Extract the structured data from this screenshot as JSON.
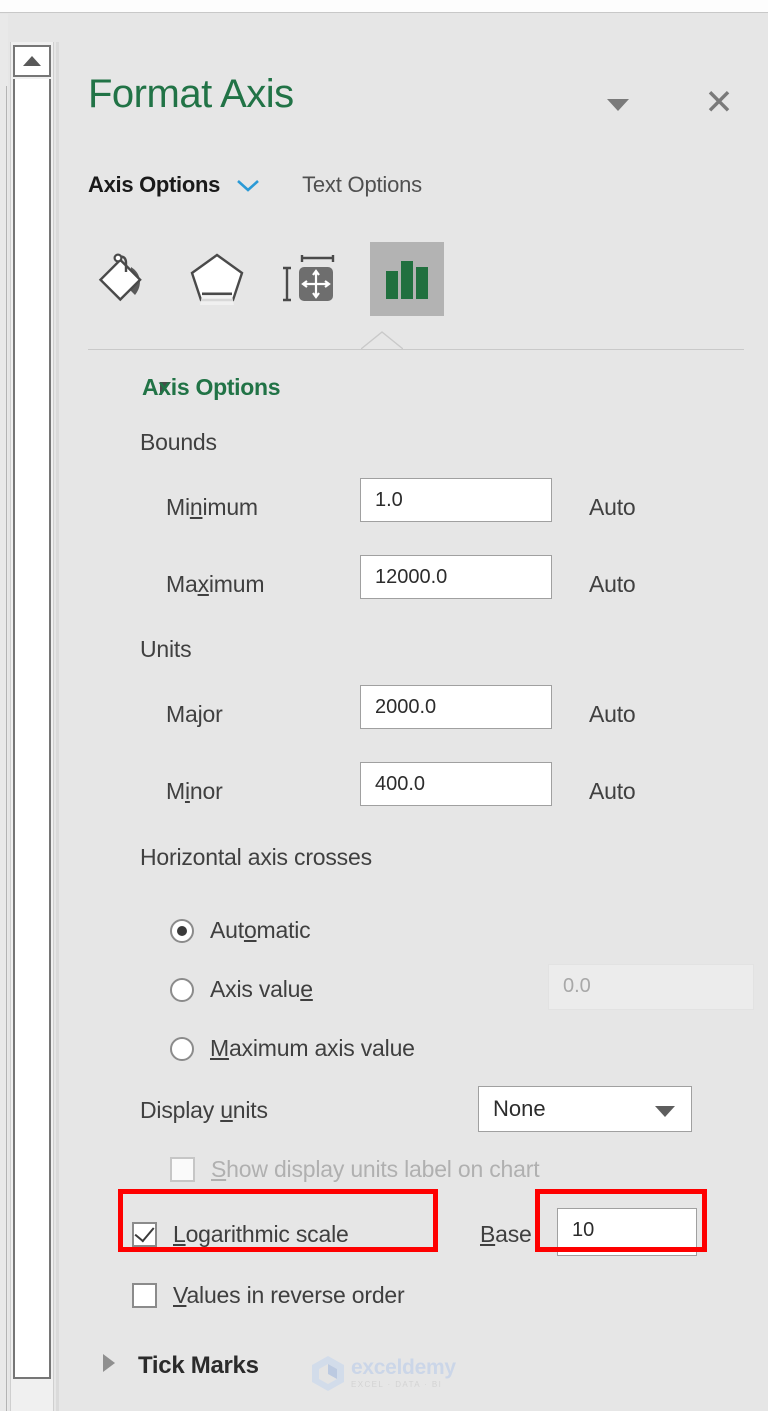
{
  "window": {
    "title": "Format Axis",
    "dropdown_icon": "caret-down-icon",
    "close_icon": "close-icon"
  },
  "tabs": {
    "axis_options": "Axis Options",
    "chevron_icon": "chevron-down-icon",
    "text_options": "Text Options"
  },
  "icon_tabs": [
    {
      "name": "fill-line-icon",
      "label": "Fill & Line",
      "selected": false
    },
    {
      "name": "effects-pentagon-icon",
      "label": "Effects",
      "selected": false
    },
    {
      "name": "size-properties-icon",
      "label": "Size & Properties",
      "selected": false
    },
    {
      "name": "axis-options-chart-icon",
      "label": "Axis Options",
      "selected": true
    }
  ],
  "section": {
    "title": "Axis Options",
    "collapse_icon": "triangle-expanded-icon"
  },
  "bounds": {
    "group_label": "Bounds",
    "minimum": {
      "label": "Minimum",
      "accel": "n",
      "value": "1.0",
      "auto_label": "Auto"
    },
    "maximum": {
      "label": "Maximum",
      "accel": "x",
      "value": "12000.0",
      "auto_label": "Auto"
    }
  },
  "units": {
    "group_label": "Units",
    "major": {
      "label": "Major",
      "accel": "j",
      "value": "2000.0",
      "auto_label": "Auto"
    },
    "minor": {
      "label": "Minor",
      "accel": "i",
      "value": "400.0",
      "auto_label": "Auto"
    }
  },
  "horizontal_axis_crosses": {
    "group_label": "Horizontal axis crosses",
    "options": [
      {
        "label": "Automatic",
        "selected": true
      },
      {
        "label": "Axis value",
        "selected": false
      },
      {
        "label": "Maximum axis value",
        "selected": false
      }
    ],
    "axis_value_field": "0.0"
  },
  "display_units": {
    "label": "Display units",
    "selected": "None",
    "caret_icon": "caret-down-icon",
    "show_label_checkbox": {
      "label": "Show display units label on chart",
      "checked": false,
      "enabled": false
    }
  },
  "logarithmic": {
    "label": "Logarithmic scale",
    "checked": true,
    "base_label": "Base",
    "base_value": "10"
  },
  "reverse_order": {
    "label": "Values in reverse order",
    "checked": false
  },
  "tick_marks": {
    "title": "Tick Marks",
    "expand_icon": "triangle-collapsed-icon"
  },
  "watermark": {
    "name": "exceldemy",
    "tagline": "EXCEL · DATA · BI"
  },
  "colors": {
    "accent_green": "#217346",
    "highlight_red": "#fe0000",
    "chevron_blue": "#2b9ad6",
    "panel_bg": "#e6e6e6"
  }
}
